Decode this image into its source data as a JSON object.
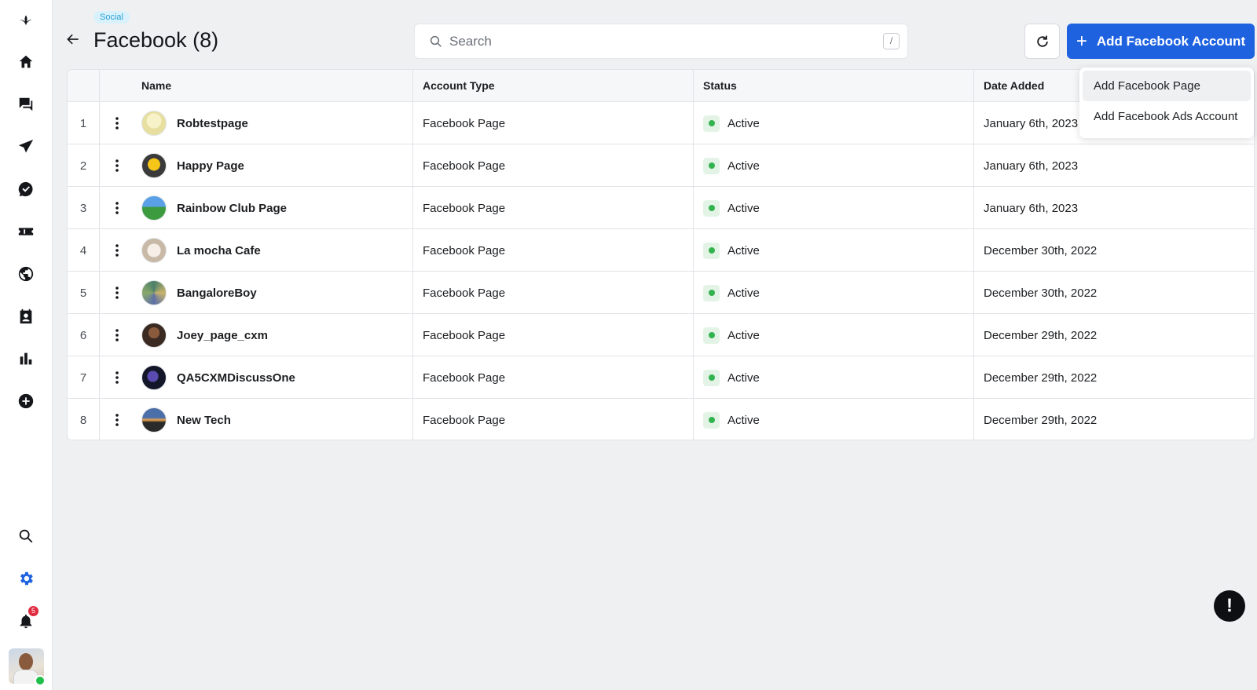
{
  "sidebar": {
    "items": [
      {
        "icon": "logo-icon"
      },
      {
        "icon": "home-icon"
      },
      {
        "icon": "chat-icon"
      },
      {
        "icon": "send-icon"
      },
      {
        "icon": "messenger-icon"
      },
      {
        "icon": "ticket-icon"
      },
      {
        "icon": "globe-icon"
      },
      {
        "icon": "contacts-icon"
      },
      {
        "icon": "bar-chart-icon"
      },
      {
        "icon": "add-circle-icon"
      }
    ],
    "bottom": [
      {
        "icon": "search-icon"
      },
      {
        "icon": "gear-icon",
        "color": "#1f62e0"
      },
      {
        "icon": "bell-icon",
        "badge": "5"
      }
    ]
  },
  "header": {
    "tag": "Social",
    "title": "Facebook (8)",
    "search_placeholder": "Search",
    "search_shortcut": "/",
    "add_button_label": "Add Facebook Account"
  },
  "table": {
    "columns": [
      "Name",
      "Account Type",
      "Status",
      "Date Added"
    ],
    "rows": [
      {
        "index": "1",
        "name": "Robtestpage",
        "type": "Facebook Page",
        "status": "Active",
        "date": "January 6th, 2023"
      },
      {
        "index": "2",
        "name": "Happy Page",
        "type": "Facebook Page",
        "status": "Active",
        "date": "January 6th, 2023"
      },
      {
        "index": "3",
        "name": "Rainbow Club Page",
        "type": "Facebook Page",
        "status": "Active",
        "date": "January 6th, 2023"
      },
      {
        "index": "4",
        "name": "La mocha Cafe",
        "type": "Facebook Page",
        "status": "Active",
        "date": "December 30th, 2022"
      },
      {
        "index": "5",
        "name": "BangaloreBoy",
        "type": "Facebook Page",
        "status": "Active",
        "date": "December 30th, 2022"
      },
      {
        "index": "6",
        "name": "Joey_page_cxm",
        "type": "Facebook Page",
        "status": "Active",
        "date": "December 29th, 2022"
      },
      {
        "index": "7",
        "name": "QA5CXMDiscussOne",
        "type": "Facebook Page",
        "status": "Active",
        "date": "December 29th, 2022"
      },
      {
        "index": "8",
        "name": "New Tech",
        "type": "Facebook Page",
        "status": "Active",
        "date": "December 29th, 2022"
      }
    ]
  },
  "dropdown": {
    "items": [
      "Add Facebook Page",
      "Add Facebook Ads Account"
    ]
  },
  "help_label": "!",
  "colors": {
    "accent": "#1f62e0",
    "active": "#33b34e",
    "badge": "#e02a3e"
  }
}
